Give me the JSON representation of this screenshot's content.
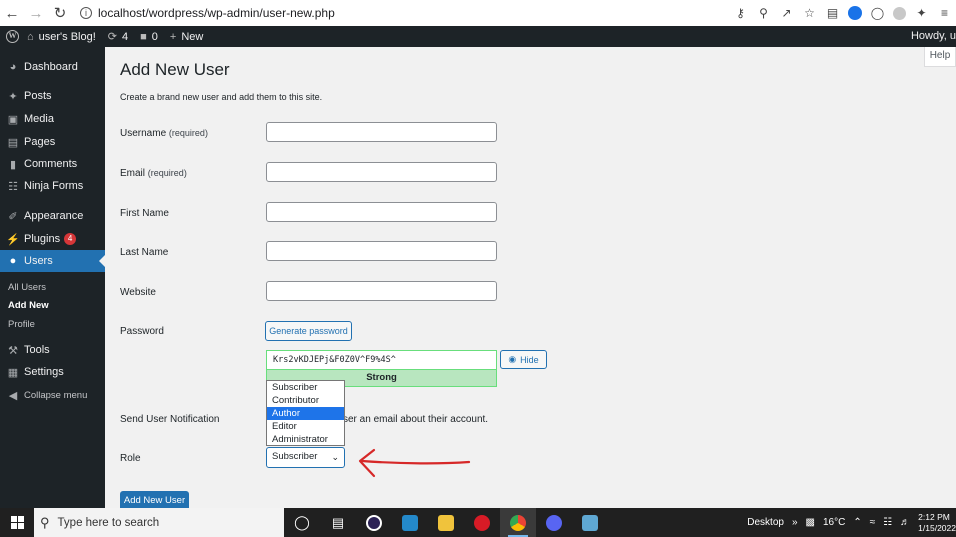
{
  "browser": {
    "url": "localhost/wordpress/wp-admin/user-new.php",
    "icons": [
      "key-icon",
      "zoom-icon",
      "share-icon",
      "star-icon",
      "reader-icon",
      "extension-blue-icon",
      "shield-icon",
      "extension-grey-icon",
      "puzzle-icon",
      "menu-icon"
    ]
  },
  "adminbar": {
    "site_name": "user's Blog!",
    "updates_count": "4",
    "comments_count": "0",
    "new_label": "New",
    "howdy": "Howdy, u"
  },
  "sidebar": {
    "items": [
      {
        "label": "Dashboard",
        "icon": "dashboard-icon"
      },
      {
        "label": "Posts",
        "icon": "pin-icon"
      },
      {
        "label": "Media",
        "icon": "media-icon"
      },
      {
        "label": "Pages",
        "icon": "pages-icon"
      },
      {
        "label": "Comments",
        "icon": "comment-icon"
      },
      {
        "label": "Ninja Forms",
        "icon": "forms-icon"
      },
      {
        "label": "Appearance",
        "icon": "brush-icon"
      },
      {
        "label": "Plugins",
        "icon": "plugin-icon",
        "badge": "4"
      },
      {
        "label": "Users",
        "icon": "user-icon"
      },
      {
        "label": "Tools",
        "icon": "wrench-icon"
      },
      {
        "label": "Settings",
        "icon": "settings-icon"
      },
      {
        "label": "Collapse menu",
        "icon": "collapse-icon"
      }
    ],
    "submenu": [
      "All Users",
      "Add New",
      "Profile"
    ]
  },
  "help_label": "Help",
  "page": {
    "title": "Add New User",
    "description": "Create a brand new user and add them to this site.",
    "fields": {
      "username": {
        "label": "Username",
        "req": "(required)",
        "value": ""
      },
      "email": {
        "label": "Email",
        "req": "(required)",
        "value": ""
      },
      "first_name": {
        "label": "First Name",
        "value": ""
      },
      "last_name": {
        "label": "Last Name",
        "value": ""
      },
      "website": {
        "label": "Website",
        "value": ""
      }
    },
    "password": {
      "label": "Password",
      "generate_label": "Generate password",
      "value": "Krs2vKDJEPj&F0Z0V^F9%4S^",
      "hide_label": "Hide",
      "strength": "Strong"
    },
    "notification": {
      "label": "Send User Notification",
      "text": "ser an email about their account."
    },
    "role": {
      "label": "Role",
      "selected": "Subscriber",
      "options": [
        "Subscriber",
        "Contributor",
        "Author",
        "Editor",
        "Administrator"
      ],
      "highlighted": "Author"
    },
    "submit_label": "Add New User"
  },
  "annotation": {
    "color": "#d62828"
  },
  "taskbar": {
    "search_placeholder": "Type here to search",
    "apps": [
      {
        "name": "task-view-icon",
        "color": "#202020"
      },
      {
        "name": "widgets-icon",
        "color": "#202020"
      },
      {
        "name": "eclipse-icon",
        "color": "#2c2255"
      },
      {
        "name": "vscode-icon",
        "color": "#2489ca"
      },
      {
        "name": "file-explorer-icon",
        "color": "#f0c33c"
      },
      {
        "name": "opera-icon",
        "color": "#d81b26"
      },
      {
        "name": "chrome-icon",
        "color": "#4caf50"
      },
      {
        "name": "discord-icon",
        "color": "#5865f2"
      },
      {
        "name": "notepad-icon",
        "color": "#5fa8d3"
      }
    ],
    "desktop_label": "Desktop",
    "temperature": "16°C",
    "time": "2:12 PM",
    "date": "1/15/2022"
  }
}
